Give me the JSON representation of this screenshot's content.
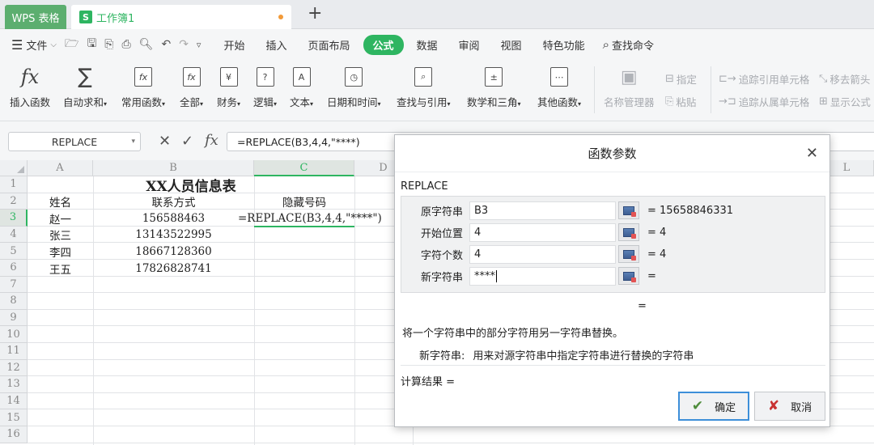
{
  "tabs": {
    "app_label": "WPS 表格",
    "book_icon": "S",
    "book_label": "工作簿1",
    "new_tab": "+"
  },
  "menu": {
    "file_label": "文件",
    "tabs": [
      "开始",
      "插入",
      "页面布局",
      "公式",
      "数据",
      "审阅",
      "视图",
      "特色功能"
    ],
    "active_tab": "公式",
    "search_label": "查找命令"
  },
  "ribbon": {
    "insert_function": "插入函数",
    "autosum": "自动求和",
    "common": "常用函数",
    "all": "全部",
    "finance": "财务",
    "logic": "逻辑",
    "text": "文本",
    "datetime": "日期和时间",
    "lookup": "查找与引用",
    "math": "数学和三角",
    "other": "其他函数",
    "name_manager": "名称管理器",
    "specify": "指定",
    "paste": "粘贴",
    "trace_precedents": "追踪引用单元格",
    "trace_dependents": "追踪从属单元格",
    "remove_arrows": "移去箭头",
    "show_formulas": "显示公式",
    "icon_text": {
      "fx": "fx",
      "sigma": "∑",
      "finance": "¥",
      "logic": "?",
      "text": "A"
    }
  },
  "formula_bar": {
    "name_box": "REPLACE",
    "formula": "=REPLACE(B3,4,4,\"****)"
  },
  "sheet": {
    "columns": [
      "A",
      "B",
      "C",
      "D",
      "L"
    ],
    "rows": [
      "1",
      "2",
      "3",
      "4",
      "5",
      "6",
      "7",
      "8",
      "9",
      "10",
      "11",
      "12",
      "13",
      "14",
      "15",
      "16"
    ],
    "title": "XX人员信息表",
    "headers": [
      "姓名",
      "联系方式",
      "隐藏号码"
    ],
    "records": [
      {
        "name": "赵一",
        "phone": "156588463",
        "hidden": "=REPLACE(B3,4,4,\"****\")"
      },
      {
        "name": "张三",
        "phone": "13143522995",
        "hidden": ""
      },
      {
        "name": "李四",
        "phone": "18667128360",
        "hidden": ""
      },
      {
        "name": "王五",
        "phone": "17826828741",
        "hidden": ""
      }
    ]
  },
  "dialog": {
    "title": "函数参数",
    "function_name": "REPLACE",
    "args": [
      {
        "label": "原字符串",
        "value": "B3",
        "result": "= 15658846331"
      },
      {
        "label": "开始位置",
        "value": "4",
        "result": "= 4"
      },
      {
        "label": "字符个数",
        "value": "4",
        "result": "= 4"
      },
      {
        "label": "新字符串",
        "value": "****",
        "result": "="
      }
    ],
    "result_eq": "=",
    "description": "将一个字符串中的部分字符用另一字符串替换。",
    "arg_desc_name": "新字符串:",
    "arg_desc_text": "用来对源字符串中指定字符串进行替换的字符串",
    "calc_result": "计算结果 =",
    "ok": "确定",
    "cancel": "取消"
  }
}
